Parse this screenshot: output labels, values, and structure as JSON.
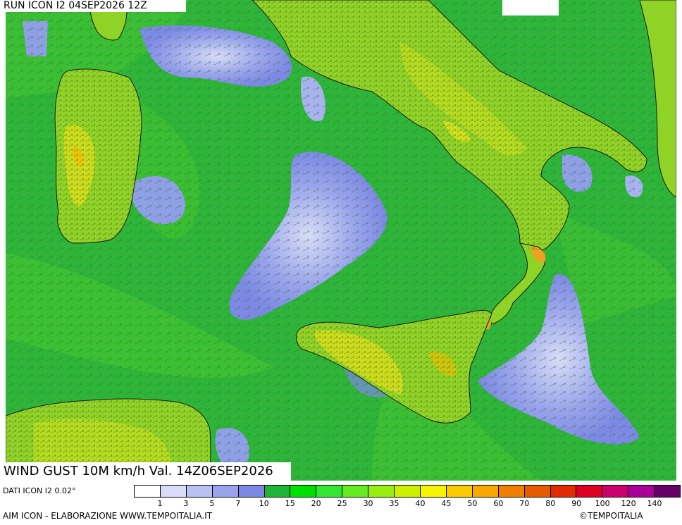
{
  "header": {
    "run_label": "RUN ICON I2 04SEP2026 12Z"
  },
  "footer": {
    "title": "WIND GUST 10M km/h Val. 14Z06SEP2026",
    "source": "DATI ICON I2 0.02°",
    "credit": "AIM ICON - ELABORAZIONE WWW.TEMPOITALIA.IT",
    "copyright": "©TEMPOITALIA"
  },
  "legend": {
    "ticks": [
      "1",
      "3",
      "5",
      "7",
      "10",
      "15",
      "20",
      "25",
      "30",
      "35",
      "40",
      "45",
      "50",
      "60",
      "70",
      "80",
      "90",
      "100",
      "120",
      "140"
    ],
    "colors": [
      "#ffffff",
      "#d8dcf8",
      "#b9c0f2",
      "#9aa4ec",
      "#7d88e4",
      "#1fb43a",
      "#00e000",
      "#33e633",
      "#66ea22",
      "#99ee11",
      "#ccf000",
      "#f5f500",
      "#f8cc00",
      "#f8a800",
      "#f07f00",
      "#e65a00",
      "#e02b00",
      "#dd0022",
      "#cc006a",
      "#aa0099",
      "#660066"
    ]
  },
  "map": {
    "sea_color": "#2fb43a",
    "calm_color": "#8f9fe6",
    "land_color": "#8fd326",
    "gust_color": "#e6e61a",
    "border_color": "#1a1a1a",
    "arrow_color": "#3a3a3a",
    "regions": [
      "sardinia",
      "corsica",
      "italy-peninsula",
      "sicily",
      "calabria",
      "tunisia"
    ]
  }
}
